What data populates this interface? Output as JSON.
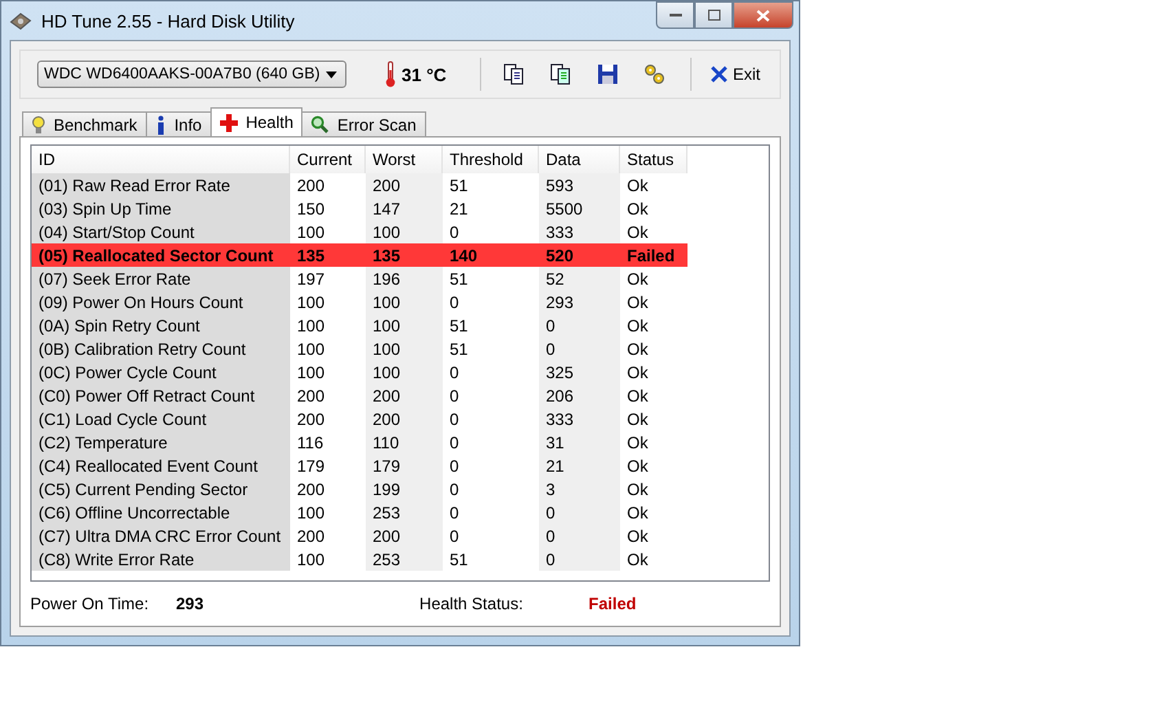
{
  "window": {
    "title": "HD Tune 2.55 - Hard Disk Utility"
  },
  "toolbar": {
    "drive": "WDC WD6400AAKS-00A7B0 (640 GB)",
    "temperature": "31 °C",
    "exit": "Exit"
  },
  "tabs": [
    {
      "label": "Benchmark",
      "selected": false,
      "kind": "bulb"
    },
    {
      "label": "Info",
      "selected": false,
      "kind": "info"
    },
    {
      "label": "Health",
      "selected": true,
      "kind": "cross"
    },
    {
      "label": "Error Scan",
      "selected": false,
      "kind": "magnifier"
    }
  ],
  "table": {
    "columns": [
      "ID",
      "Current",
      "Worst",
      "Threshold",
      "Data",
      "Status"
    ],
    "rows": [
      {
        "cells": [
          "(01) Raw Read Error Rate",
          "200",
          "200",
          "51",
          "593",
          "Ok"
        ],
        "failed": false
      },
      {
        "cells": [
          "(03) Spin Up Time",
          "150",
          "147",
          "21",
          "5500",
          "Ok"
        ],
        "failed": false
      },
      {
        "cells": [
          "(04) Start/Stop Count",
          "100",
          "100",
          "0",
          "333",
          "Ok"
        ],
        "failed": false
      },
      {
        "cells": [
          "(05) Reallocated Sector Count",
          "135",
          "135",
          "140",
          "520",
          "Failed"
        ],
        "failed": true
      },
      {
        "cells": [
          "(07) Seek Error Rate",
          "197",
          "196",
          "51",
          "52",
          "Ok"
        ],
        "failed": false
      },
      {
        "cells": [
          "(09) Power On Hours Count",
          "100",
          "100",
          "0",
          "293",
          "Ok"
        ],
        "failed": false
      },
      {
        "cells": [
          "(0A) Spin Retry Count",
          "100",
          "100",
          "51",
          "0",
          "Ok"
        ],
        "failed": false
      },
      {
        "cells": [
          "(0B) Calibration Retry Count",
          "100",
          "100",
          "51",
          "0",
          "Ok"
        ],
        "failed": false
      },
      {
        "cells": [
          "(0C) Power Cycle Count",
          "100",
          "100",
          "0",
          "325",
          "Ok"
        ],
        "failed": false
      },
      {
        "cells": [
          "(C0) Power Off Retract Count",
          "200",
          "200",
          "0",
          "206",
          "Ok"
        ],
        "failed": false
      },
      {
        "cells": [
          "(C1) Load Cycle Count",
          "200",
          "200",
          "0",
          "333",
          "Ok"
        ],
        "failed": false
      },
      {
        "cells": [
          "(C2) Temperature",
          "116",
          "110",
          "0",
          "31",
          "Ok"
        ],
        "failed": false
      },
      {
        "cells": [
          "(C4) Reallocated Event Count",
          "179",
          "179",
          "0",
          "21",
          "Ok"
        ],
        "failed": false
      },
      {
        "cells": [
          "(C5) Current Pending Sector",
          "200",
          "199",
          "0",
          "3",
          "Ok"
        ],
        "failed": false
      },
      {
        "cells": [
          "(C6) Offline Uncorrectable",
          "100",
          "253",
          "0",
          "0",
          "Ok"
        ],
        "failed": false
      },
      {
        "cells": [
          "(C7) Ultra DMA CRC Error Count",
          "200",
          "200",
          "0",
          "0",
          "Ok"
        ],
        "failed": false
      },
      {
        "cells": [
          "(C8) Write Error Rate",
          "100",
          "253",
          "51",
          "0",
          "Ok"
        ],
        "failed": false
      }
    ]
  },
  "footer": {
    "power_on_label": "Power On Time:",
    "power_on_value": "293",
    "health_label": "Health Status:",
    "health_value": "Failed",
    "health_failed": true
  }
}
